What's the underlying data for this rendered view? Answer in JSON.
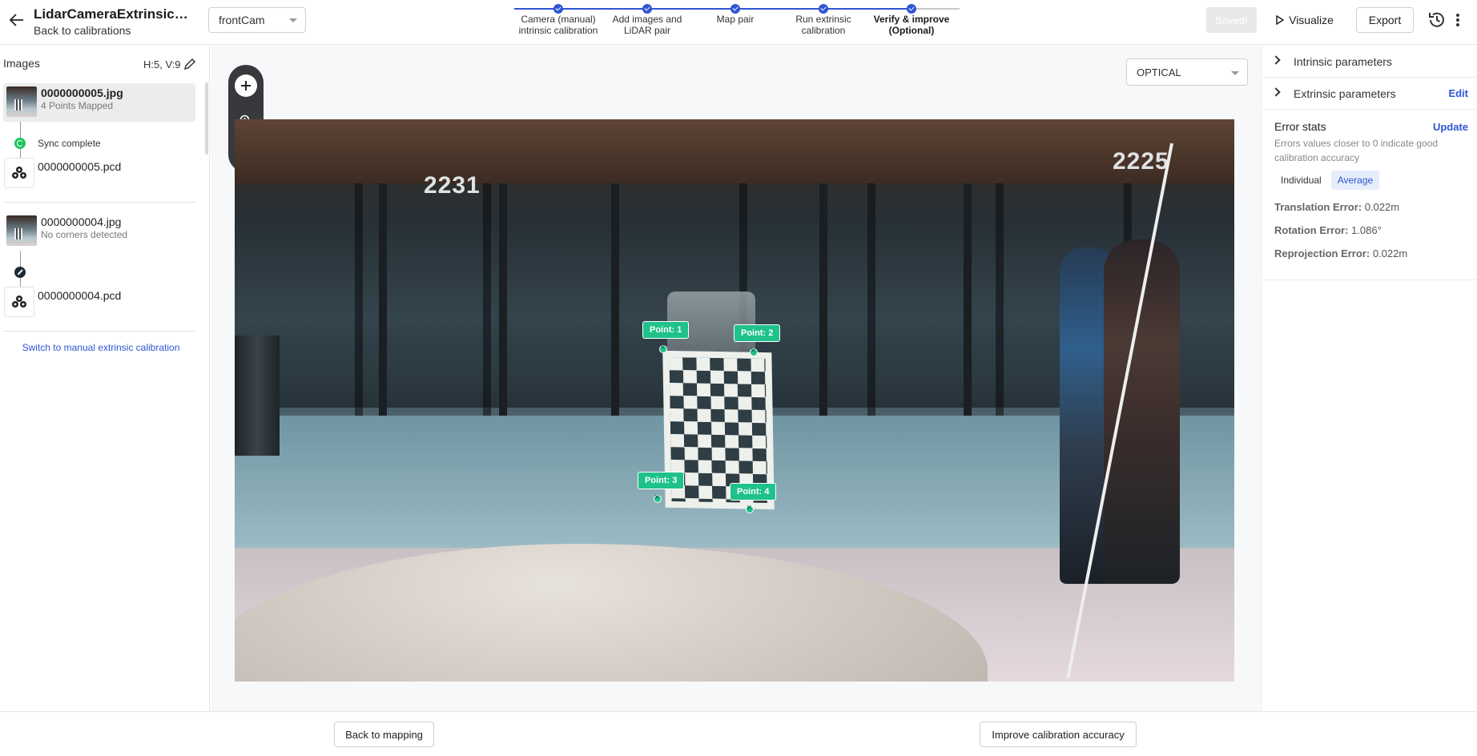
{
  "header": {
    "title": "LidarCameraExtrinsicDe...",
    "back_label": "Back to calibrations",
    "camera_select": "frontCam",
    "steps": [
      {
        "label": "Camera (manual) intrinsic calibration",
        "active": false
      },
      {
        "label": "Add images and LiDAR pair",
        "active": false
      },
      {
        "label": "Map pair",
        "active": false
      },
      {
        "label": "Run extrinsic calibration",
        "active": false
      },
      {
        "label": "Verify & improve (Optional)",
        "active": true
      }
    ],
    "saved_label": "Saved!",
    "visualize_label": "Visualize",
    "export_label": "Export"
  },
  "left": {
    "images_header": "Images",
    "hv_count": "H:5, V:9",
    "items": [
      {
        "image": "0000000005.jpg",
        "image_status": "4 Points Mapped",
        "sync": "Sync complete",
        "pcd": "0000000005.pcd"
      },
      {
        "image": "0000000004.jpg",
        "image_status": "No corners detected",
        "sync": "",
        "pcd": "0000000004.pcd"
      }
    ],
    "switch_link": "Switch to manual extrinsic calibration"
  },
  "canvas": {
    "mode": "OPTICAL",
    "signs": [
      "2231",
      "2225"
    ],
    "points": [
      {
        "label": "Point: 1"
      },
      {
        "label": "Point: 2"
      },
      {
        "label": "Point: 3"
      },
      {
        "label": "Point: 4"
      }
    ]
  },
  "right": {
    "intrinsic_label": "Intrinsic parameters",
    "extrinsic_label": "Extrinsic parameters",
    "edit_label": "Edit",
    "error_title": "Error stats",
    "update_label": "Update",
    "error_desc": "Errors values closer to 0 indicate good calibration accuracy",
    "tabs": [
      "Individual",
      "Average"
    ],
    "active_tab": "Average",
    "metrics": [
      {
        "name": "Translation Error:",
        "value": "0.022m"
      },
      {
        "name": "Rotation Error:",
        "value": "1.086°"
      },
      {
        "name": "Reprojection Error:",
        "value": "0.022m"
      }
    ]
  },
  "footer": {
    "back_mapping": "Back to mapping",
    "improve": "Improve calibration accuracy"
  },
  "colors": {
    "accent": "#2f55d4",
    "point": "#1ec28a",
    "sync_ok": "#1ec45a"
  }
}
